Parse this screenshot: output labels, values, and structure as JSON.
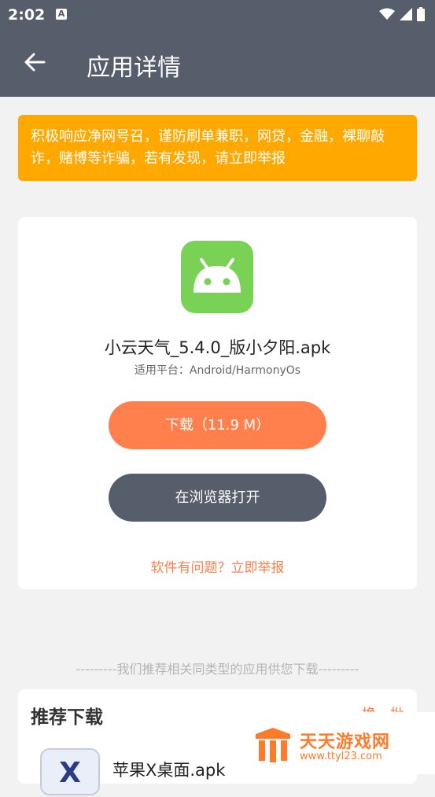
{
  "status_bar": {
    "time": "2:02",
    "notification_icon": "A"
  },
  "header": {
    "title": "应用详情"
  },
  "notice": {
    "text": "积极响应净网号召，谨防刷单兼职，网贷，金融，裸聊敲诈，赌博等诈骗，若有发现，请立即举报"
  },
  "app": {
    "name": "小云天气_5.4.0_版小夕阳.apk",
    "platform": "适用平台：Android/HarmonyOs",
    "download_label": "下载（11.9 M）",
    "browser_label": "在浏览器打开",
    "report_label": "软件有问题？立即举报"
  },
  "recommend": {
    "caption": "---------我们推荐相关同类型的应用供您下载---------",
    "title": "推荐下载",
    "refresh_label": "换一批",
    "items": [
      {
        "name": "苹果X桌面.apk",
        "icon_letter": "X"
      }
    ]
  },
  "watermark": {
    "name": "天天游戏网",
    "url": "www.ttyl23.com"
  },
  "colors": {
    "header": "#565d6b",
    "notice": "#ffa800",
    "accent": "#ff7f4d",
    "app_icon": "#79d156"
  }
}
